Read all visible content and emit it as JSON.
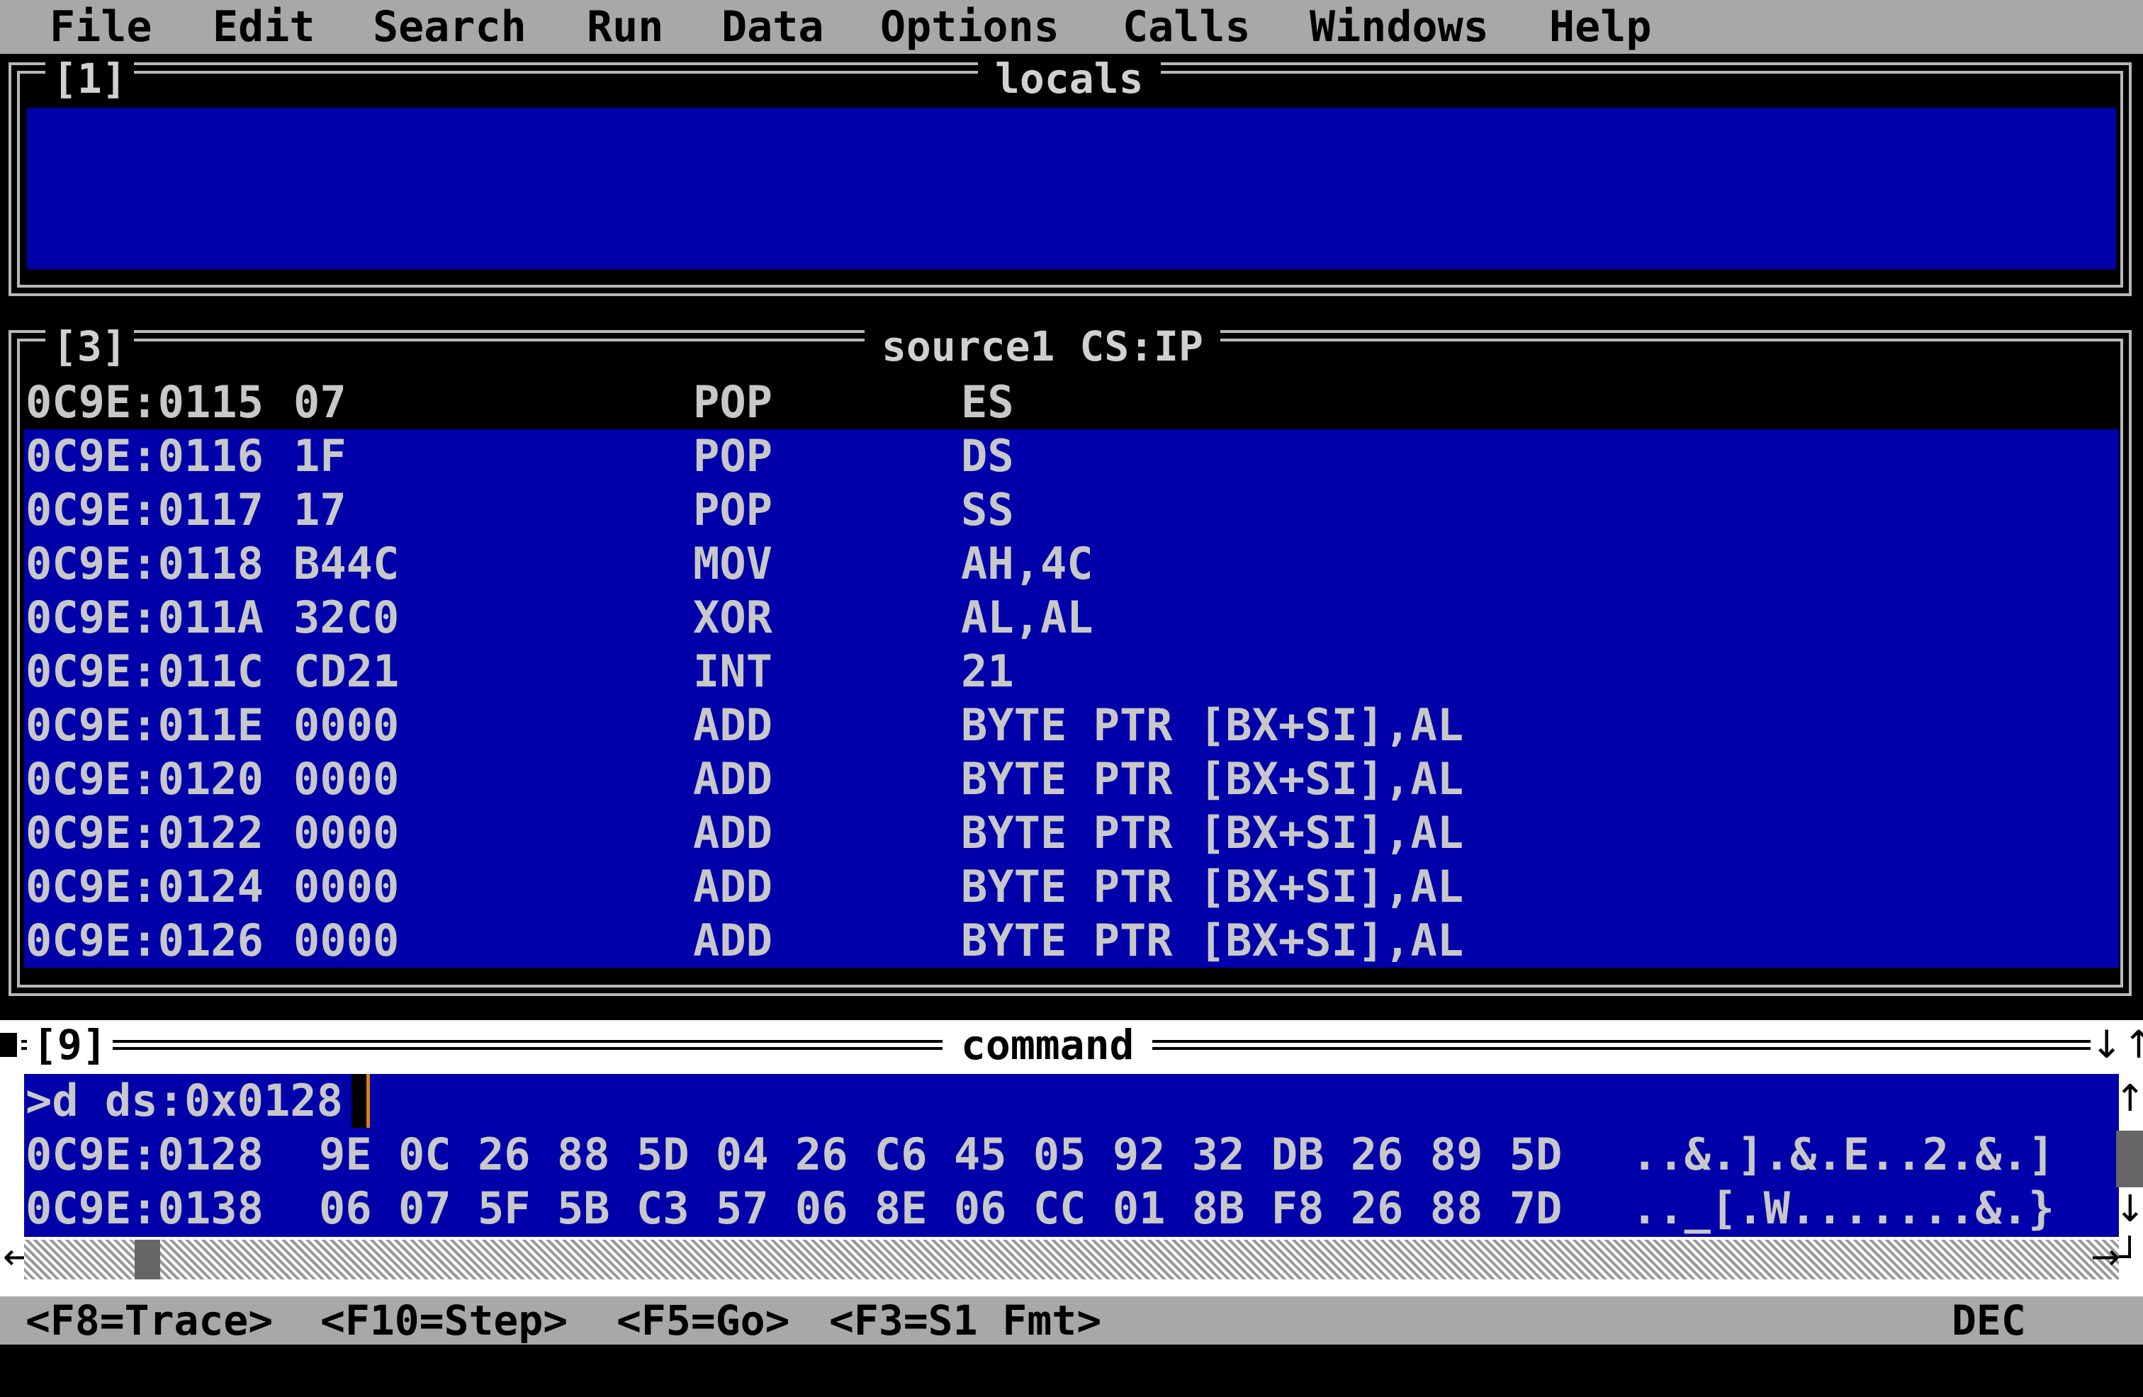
{
  "menu": [
    "File",
    "Edit",
    "Search",
    "Run",
    "Data",
    "Options",
    "Calls",
    "Windows",
    "Help"
  ],
  "locals": {
    "number": "[1]",
    "title": "locals"
  },
  "source": {
    "number": "[3]",
    "title": "source1 CS:IP",
    "rows": [
      {
        "addr": "0C9E:0115",
        "bytes": "07",
        "op": "POP",
        "args": "ES"
      },
      {
        "addr": "0C9E:0116",
        "bytes": "1F",
        "op": "POP",
        "args": "DS"
      },
      {
        "addr": "0C9E:0117",
        "bytes": "17",
        "op": "POP",
        "args": "SS"
      },
      {
        "addr": "0C9E:0118",
        "bytes": "B44C",
        "op": "MOV",
        "args": "AH,4C"
      },
      {
        "addr": "0C9E:011A",
        "bytes": "32C0",
        "op": "XOR",
        "args": "AL,AL"
      },
      {
        "addr": "0C9E:011C",
        "bytes": "CD21",
        "op": "INT",
        "args": "21"
      },
      {
        "addr": "0C9E:011E",
        "bytes": "0000",
        "op": "ADD",
        "args": "BYTE PTR [BX+SI],AL"
      },
      {
        "addr": "0C9E:0120",
        "bytes": "0000",
        "op": "ADD",
        "args": "BYTE PTR [BX+SI],AL"
      },
      {
        "addr": "0C9E:0122",
        "bytes": "0000",
        "op": "ADD",
        "args": "BYTE PTR [BX+SI],AL"
      },
      {
        "addr": "0C9E:0124",
        "bytes": "0000",
        "op": "ADD",
        "args": "BYTE PTR [BX+SI],AL"
      },
      {
        "addr": "0C9E:0126",
        "bytes": "0000",
        "op": "ADD",
        "args": "BYTE PTR [BX+SI],AL"
      }
    ]
  },
  "command": {
    "number": "[9]",
    "title": "command",
    "prompt": ">d ds:0x0128",
    "dump": [
      {
        "addr": "0C9E:0128",
        "hex": "9E 0C 26 88 5D 04 26 C6 45 05 92 32 DB 26 89 5D",
        "ascii": "..&.].&.E..2.&.]"
      },
      {
        "addr": "0C9E:0138",
        "hex": "06 07 5F 5B C3 57 06 8E 06 CC 01 8B F8 26 88 7D",
        "ascii": ".._[.W.......&.}"
      }
    ]
  },
  "status": {
    "keys": [
      "<F8=Trace>",
      "<F10=Step>",
      "<F5=Go>",
      "<F3=S1 Fmt>"
    ],
    "radix": "DEC"
  }
}
